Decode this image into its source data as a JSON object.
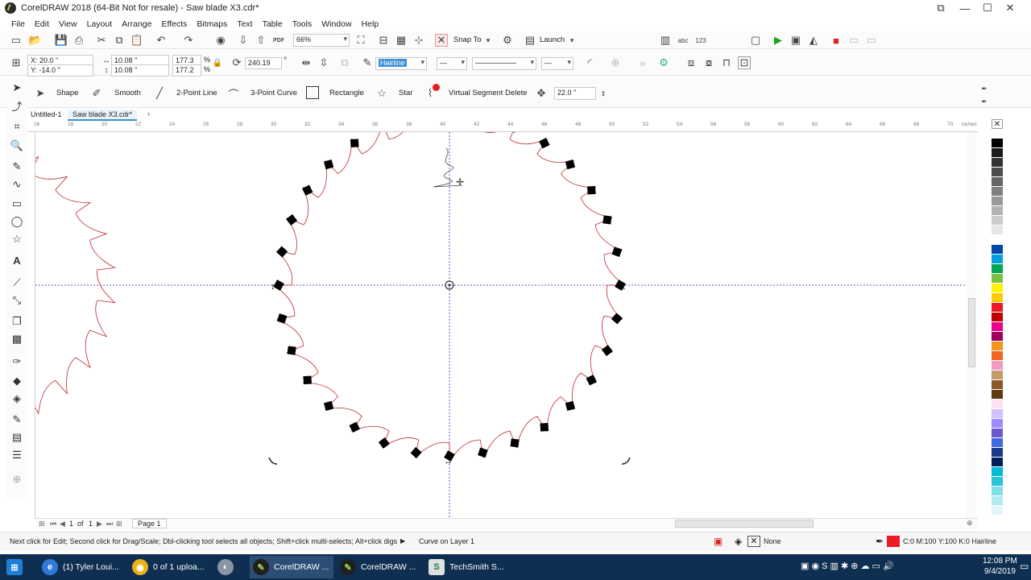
{
  "window": {
    "title": "CorelDRAW 2018 (64-Bit Not for resale) - Saw blade X3.cdr*",
    "min_label": "—",
    "max_label": "☐",
    "close_label": "✕"
  },
  "menu": [
    "File",
    "Edit",
    "View",
    "Layout",
    "Arrange",
    "Effects",
    "Bitmaps",
    "Text",
    "Table",
    "Tools",
    "Window",
    "Help"
  ],
  "standard_toolbar": {
    "zoom_value": "66%",
    "snap_to_label": "Snap To",
    "launch_label": "Launch",
    "pdf_label": "PDF"
  },
  "property_bar": {
    "x_value": "X: 20.0 \"",
    "y_value": "Y: -14.0 \"",
    "width_value": "10.08 \"",
    "height_value": "10.08 \"",
    "scale_x": "177.3",
    "scale_y": "177.2",
    "pct": "%",
    "angle_value": "240.19",
    "angle_unit": "°",
    "outline_width": "Hairline"
  },
  "shape_bar": {
    "shape_label": "Shape",
    "smooth_label": "Smooth",
    "two_point_line_label": "2-Point Line",
    "three_point_curve_label": "3-Point Curve",
    "rectangle_label": "Rectangle",
    "star_label": "Star",
    "virtual_segment_label": "Virtual Segment Delete",
    "nudge_value": "22.0 \""
  },
  "document_tabs": [
    "Untitled-1",
    "Saw blade X3.cdr*"
  ],
  "add_tab_label": "+",
  "ruler": {
    "ticks": [
      "16",
      "18",
      "20",
      "22",
      "24",
      "26",
      "28",
      "30",
      "32",
      "34",
      "36",
      "38",
      "40",
      "42",
      "44",
      "46",
      "48",
      "50",
      "52",
      "54",
      "56",
      "58",
      "60",
      "62",
      "64",
      "66",
      "68",
      "70"
    ],
    "units": "inches"
  },
  "page_navigator": {
    "current": "1",
    "of_label": "of",
    "total": "1",
    "page_tab": "Page 1"
  },
  "status_bar": {
    "hint": "Next click for Edit; Second click for Drag/Scale; Dbl-clicking tool selects all objects; Shift+click multi-selects; Alt+click digs",
    "object_info": "Curve on Layer 1",
    "fill_label": "None",
    "outline_info": "C:0 M:100 Y:100 K:0  Hairline"
  },
  "palette_colors": [
    "#ffffff",
    "#000000",
    "#1a1a1a",
    "#333333",
    "#4d4d4d",
    "#666666",
    "#808080",
    "#999999",
    "#b3b3b3",
    "#cccccc",
    "#e6e6e6",
    "#ffffff",
    "#0047ab",
    "#00a0e0",
    "#00a651",
    "#7ac143",
    "#fff200",
    "#ffcc00",
    "#ed1c24",
    "#c00000",
    "#ec008c",
    "#9e005d",
    "#f7941d",
    "#f26522",
    "#f49ac1",
    "#c49a6c",
    "#8b5a2b",
    "#603913",
    "#ffe0f0",
    "#d0c0ff",
    "#9c8cff",
    "#6a5acd",
    "#4169e1",
    "#1e3a8a",
    "#001f5c",
    "#00bcd4",
    "#26c6da",
    "#80deea",
    "#b2ebf2",
    "#e0f7fa"
  ],
  "accent_color": "#ed1c24",
  "taskbar": {
    "items": [
      {
        "label": "(1) Tyler Loui...",
        "icon": "edge-icon"
      },
      {
        "label": "0 of 1 uploa...",
        "icon": "chrome-icon"
      },
      {
        "label": "CorelDRAW ...",
        "icon": "coreldraw-icon"
      },
      {
        "label": "CorelDRAW ...",
        "icon": "coreldraw-icon"
      },
      {
        "label": "TechSmith S...",
        "icon": "techsmith-icon"
      }
    ],
    "time": "12:08 PM",
    "date": "9/4/2019"
  }
}
